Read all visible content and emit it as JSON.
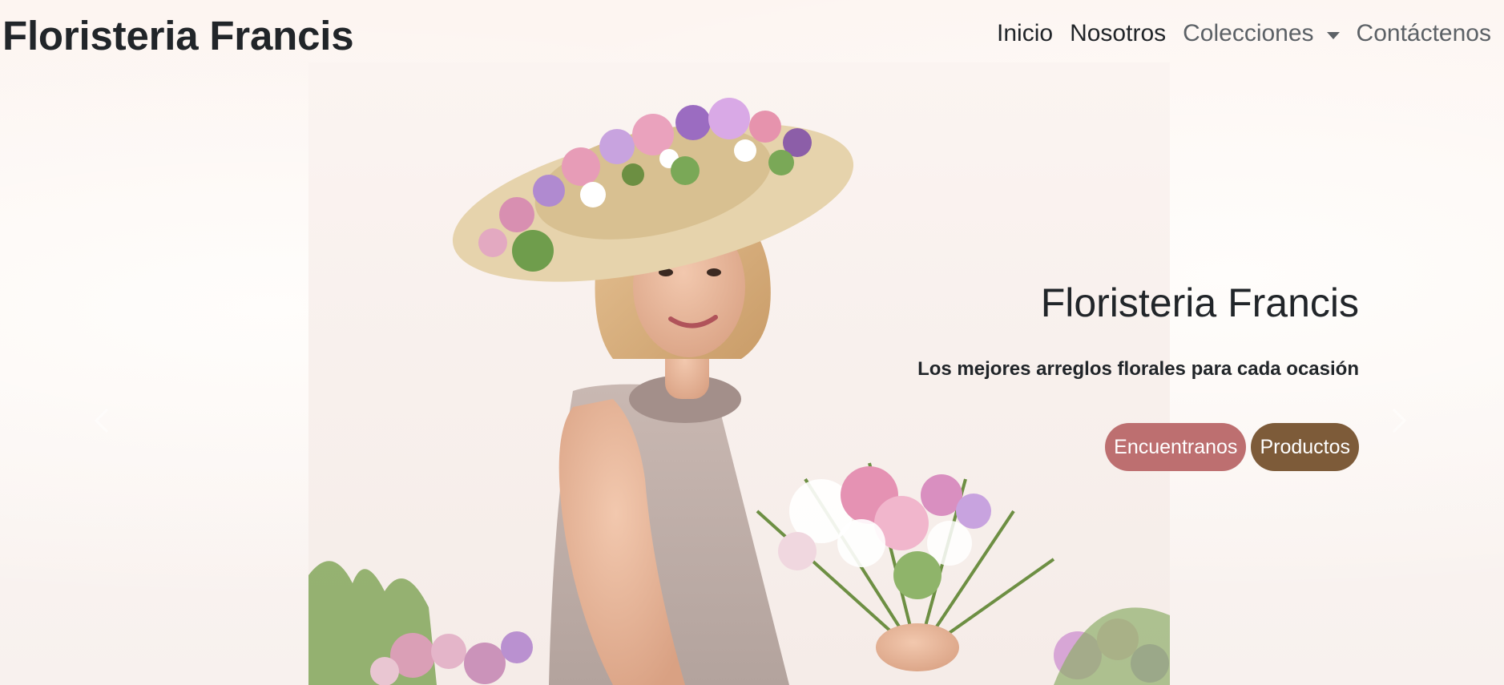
{
  "navbar": {
    "brand": "Floristeria Francis",
    "links": [
      {
        "label": "Inicio"
      },
      {
        "label": "Nosotros"
      },
      {
        "label": "Colecciones",
        "has_dropdown": true
      },
      {
        "label": "Contáctenos"
      }
    ]
  },
  "hero": {
    "title": "Floristeria Francis",
    "subtitle": "Los mejores arreglos florales para cada ocasión",
    "buttons": {
      "find": "Encuentranos",
      "products": "Productos"
    },
    "icons": {
      "prev": "chevron-left-icon",
      "next": "chevron-right-icon",
      "dropdown": "caret-down-icon"
    }
  },
  "colors": {
    "background": "#fbf7f4",
    "text": "#212529",
    "muted_link": "#5c6166",
    "button_find": "#bd6f70",
    "button_products": "#7d5b39"
  }
}
